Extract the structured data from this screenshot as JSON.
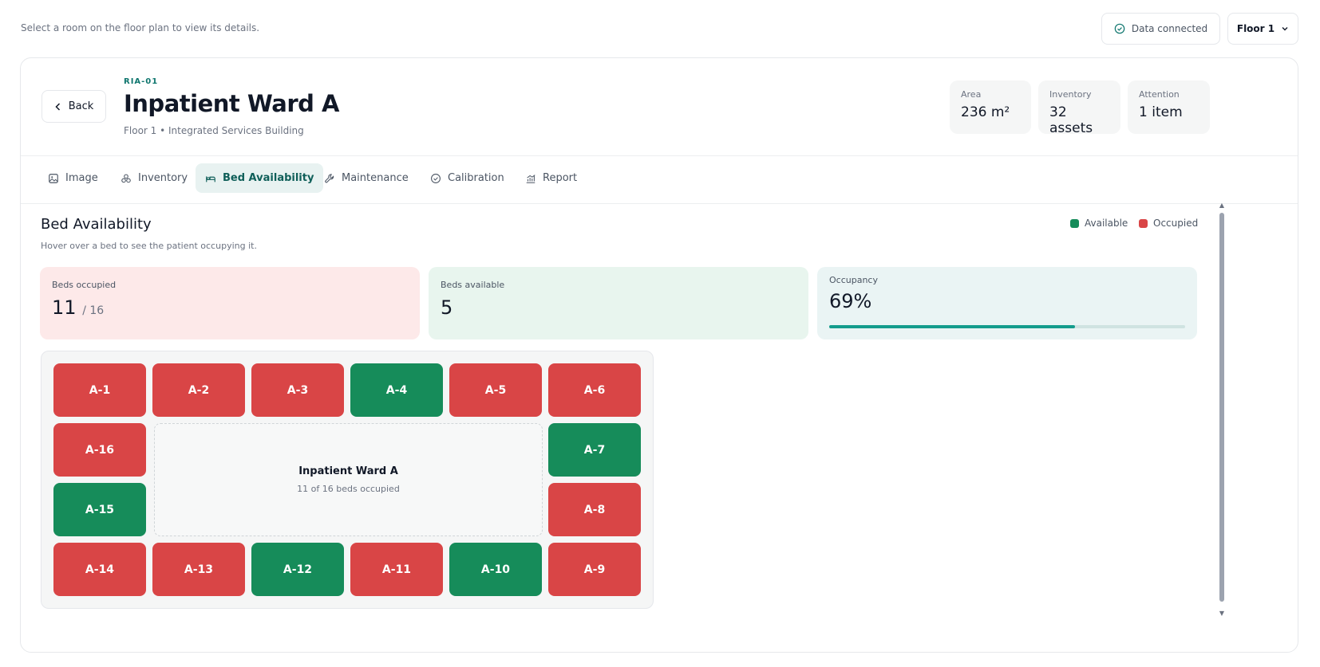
{
  "header": {
    "hint": "Select a room on the floor plan to view its details.",
    "connection": "Data connected",
    "floor_select": "Floor 1"
  },
  "room": {
    "back_label": "Back",
    "code": "RIA-01",
    "name": "Inpatient Ward A",
    "location": "Floor 1 • Integrated Services Building",
    "stats": [
      {
        "label": "Area",
        "value": "236 m²"
      },
      {
        "label": "Inventory",
        "value": "32 assets"
      },
      {
        "label": "Attention",
        "value": "1 item"
      }
    ]
  },
  "tabs": [
    {
      "label": "Image",
      "icon": "image-icon",
      "active": false
    },
    {
      "label": "Inventory",
      "icon": "boxes-icon",
      "active": false
    },
    {
      "label": "Bed Availability",
      "icon": "bed-icon",
      "active": true
    },
    {
      "label": "Maintenance",
      "icon": "wrench-icon",
      "active": false
    },
    {
      "label": "Calibration",
      "icon": "check-circle-icon",
      "active": false
    },
    {
      "label": "Report",
      "icon": "chart-icon",
      "active": false
    }
  ],
  "beds_section": {
    "title": "Bed Availability",
    "subtitle": "Hover over a bed to see the patient occupying it.",
    "legend": {
      "available": "Available",
      "occupied": "Occupied"
    },
    "colors": {
      "available": "#168c5a",
      "occupied": "#d94546",
      "accent": "#0f766e"
    },
    "kpis": {
      "occupied_label": "Beds occupied",
      "occupied_value": "11",
      "occupied_total": "/ 16",
      "available_label": "Beds available",
      "available_value": "5",
      "occupancy_label": "Occupancy",
      "occupancy_value": "69%",
      "occupancy_fraction": 0.69
    },
    "center": {
      "title": "Inpatient Ward A",
      "subtitle": "11 of 16 beds occupied"
    },
    "beds": [
      {
        "id": "A-1",
        "status": "occupied"
      },
      {
        "id": "A-2",
        "status": "occupied"
      },
      {
        "id": "A-3",
        "status": "occupied"
      },
      {
        "id": "A-4",
        "status": "available"
      },
      {
        "id": "A-5",
        "status": "occupied"
      },
      {
        "id": "A-6",
        "status": "occupied"
      },
      {
        "id": "A-7",
        "status": "available"
      },
      {
        "id": "A-8",
        "status": "occupied"
      },
      {
        "id": "A-9",
        "status": "occupied"
      },
      {
        "id": "A-10",
        "status": "available"
      },
      {
        "id": "A-11",
        "status": "occupied"
      },
      {
        "id": "A-12",
        "status": "available"
      },
      {
        "id": "A-13",
        "status": "occupied"
      },
      {
        "id": "A-14",
        "status": "occupied"
      },
      {
        "id": "A-15",
        "status": "available"
      },
      {
        "id": "A-16",
        "status": "occupied"
      }
    ]
  }
}
